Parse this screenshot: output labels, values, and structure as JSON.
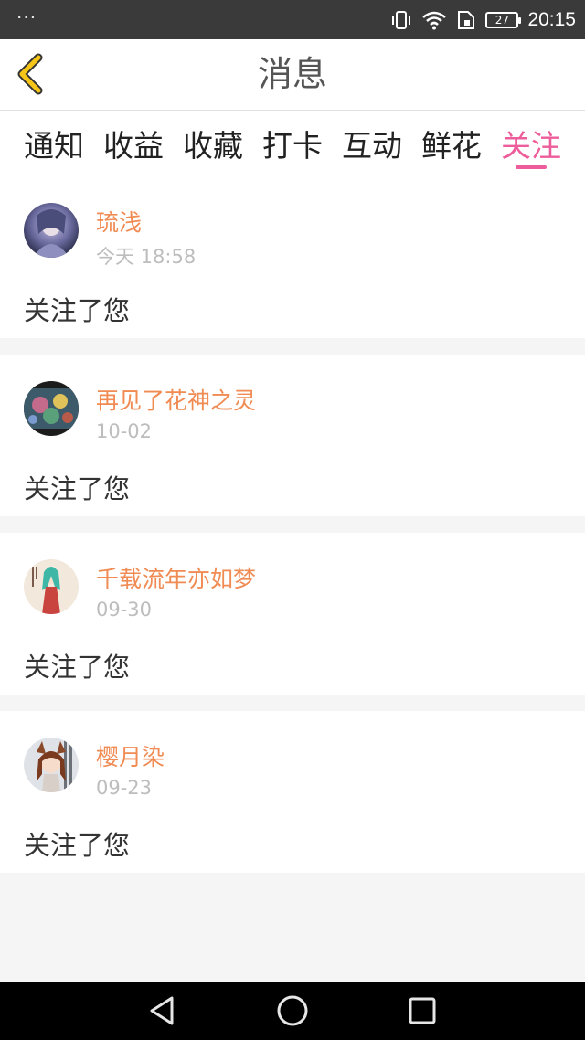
{
  "status_bar": {
    "dots": "···",
    "battery_level": "27",
    "time": "20:15",
    "icons": [
      "vibrate-icon",
      "wifi-icon",
      "sim-card-icon",
      "battery-icon"
    ]
  },
  "header": {
    "title": "消息",
    "back_icon": "chevron-left-icon",
    "accent_color": "#f5c518"
  },
  "tabs": [
    {
      "label": "通知",
      "active": false
    },
    {
      "label": "收益",
      "active": false
    },
    {
      "label": "收藏",
      "active": false
    },
    {
      "label": "打卡",
      "active": false
    },
    {
      "label": "互动",
      "active": false
    },
    {
      "label": "鲜花",
      "active": false
    },
    {
      "label": "关注",
      "active": true
    }
  ],
  "messages": [
    {
      "username": "琉浅",
      "time": "今天 18:58",
      "text": "关注了您"
    },
    {
      "username": "再见了花神之灵",
      "time": "10-02",
      "text": "关注了您"
    },
    {
      "username": "千载流年亦如梦",
      "time": "09-30",
      "text": "关注了您"
    },
    {
      "username": "樱月染",
      "time": "09-23",
      "text": "关注了您"
    }
  ],
  "colors": {
    "active_tab": "#ee5d9b",
    "username": "#f08b53",
    "timestamp": "#bdbdbd"
  },
  "nav_bar": {
    "icons": [
      "back-triangle-icon",
      "home-circle-icon",
      "recents-square-icon"
    ]
  }
}
